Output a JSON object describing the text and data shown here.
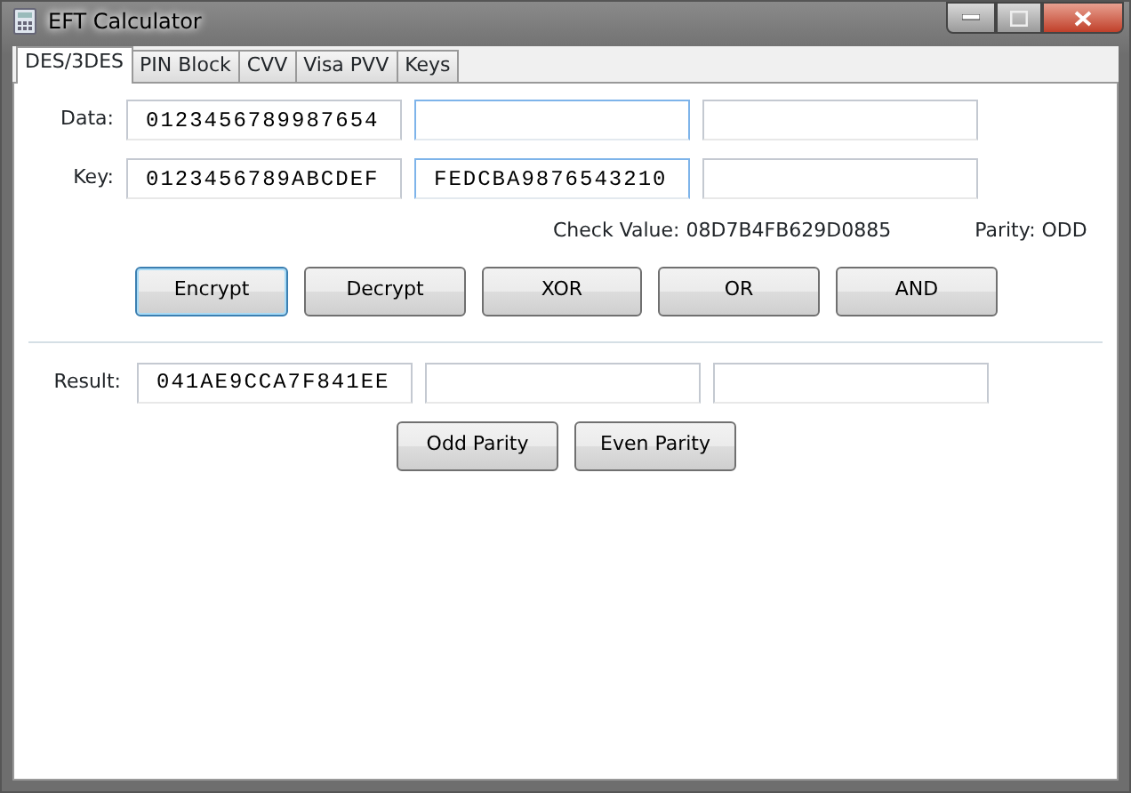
{
  "window": {
    "title": "EFT Calculator"
  },
  "tabs": [
    {
      "label": "DES/3DES",
      "selected": true
    },
    {
      "label": "PIN Block",
      "selected": false
    },
    {
      "label": "CVV",
      "selected": false
    },
    {
      "label": "Visa PVV",
      "selected": false
    },
    {
      "label": "Keys",
      "selected": false
    }
  ],
  "rows": [
    {
      "label": "Data:",
      "fields": [
        {
          "value": "0123456789987654",
          "highlighted": false
        },
        {
          "highlighted": true
        },
        {
          "highlighted": false
        }
      ]
    },
    {
      "label": "Key:",
      "fields": [
        {
          "value": "0123456789ABCDEF",
          "highlighted": false
        },
        {
          "value": "FEDCBA9876543210",
          "highlighted": true
        },
        {
          "highlighted": false
        }
      ]
    }
  ],
  "check_value": "Check Value: 08D7B4FB629D0885",
  "parity": "Parity: ODD",
  "operation_buttons": [
    {
      "label": "Encrypt",
      "focused": true
    },
    {
      "label": "Decrypt",
      "focused": false
    },
    {
      "label": "XOR",
      "focused": false
    },
    {
      "label": "OR",
      "focused": false
    },
    {
      "label": "AND",
      "focused": false
    }
  ],
  "result": {
    "label": "Result:",
    "fields": [
      {
        "value": "041AE9CCA7F841EE",
        "highlighted": false
      },
      {
        "highlighted": false
      },
      {
        "highlighted": false
      }
    ]
  },
  "parity_buttons": [
    {
      "label": "Odd Parity",
      "focused": false
    },
    {
      "label": "Even Parity",
      "focused": false
    }
  ]
}
